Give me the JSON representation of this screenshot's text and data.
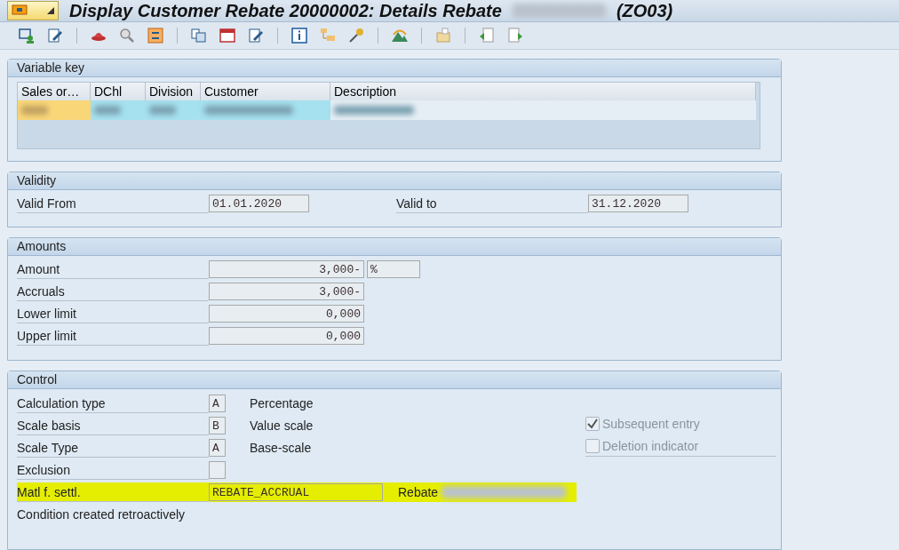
{
  "window": {
    "title": "Display Customer Rebate 20000002: Details Rebate",
    "title_suffix": "(ZO03)"
  },
  "variable_key": {
    "title": "Variable key",
    "columns": [
      {
        "label": "Sales or…",
        "kind": "org"
      },
      {
        "label": "DChl",
        "kind": "key"
      },
      {
        "label": "Division",
        "kind": "key"
      },
      {
        "label": "Customer",
        "kind": "key"
      },
      {
        "label": "Description",
        "kind": "text"
      }
    ]
  },
  "validity": {
    "title": "Validity",
    "fields": [
      {
        "label": "Valid From",
        "value": "01.01.2020"
      },
      {
        "label": "Valid to",
        "value": "31.12.2020"
      }
    ]
  },
  "amounts": {
    "title": "Amounts",
    "rows": [
      {
        "label": "Amount",
        "value": "3,000-",
        "unit": "%"
      },
      {
        "label": "Accruals",
        "value": "3,000-"
      },
      {
        "label": "Lower limit",
        "value": "0,000"
      },
      {
        "label": "Upper limit",
        "value": "0,000"
      }
    ]
  },
  "control": {
    "title": "Control",
    "rows": [
      {
        "kind": "code",
        "label": "Calculation type",
        "code": "A",
        "text": "Percentage",
        "highlighted": false
      },
      {
        "kind": "code",
        "label": "Scale basis",
        "code": "B",
        "text": "Value scale",
        "highlighted": false
      },
      {
        "kind": "code",
        "label": "Scale Type",
        "code": "A",
        "text": "Base-scale",
        "highlighted": false
      },
      {
        "kind": "code",
        "label": "Exclusion",
        "highlighted": false
      },
      {
        "kind": "input",
        "label": "Matl f. settl.",
        "value": "REBATE_ACCRUAL",
        "text": "Rebate",
        "highlighted": true
      }
    ],
    "note": "Condition created retroactively",
    "checkboxes": [
      {
        "label": "Subsequent entry",
        "checked": true,
        "disabled": true
      },
      {
        "label": "Deletion indicator",
        "checked": false,
        "disabled": true
      }
    ]
  }
}
